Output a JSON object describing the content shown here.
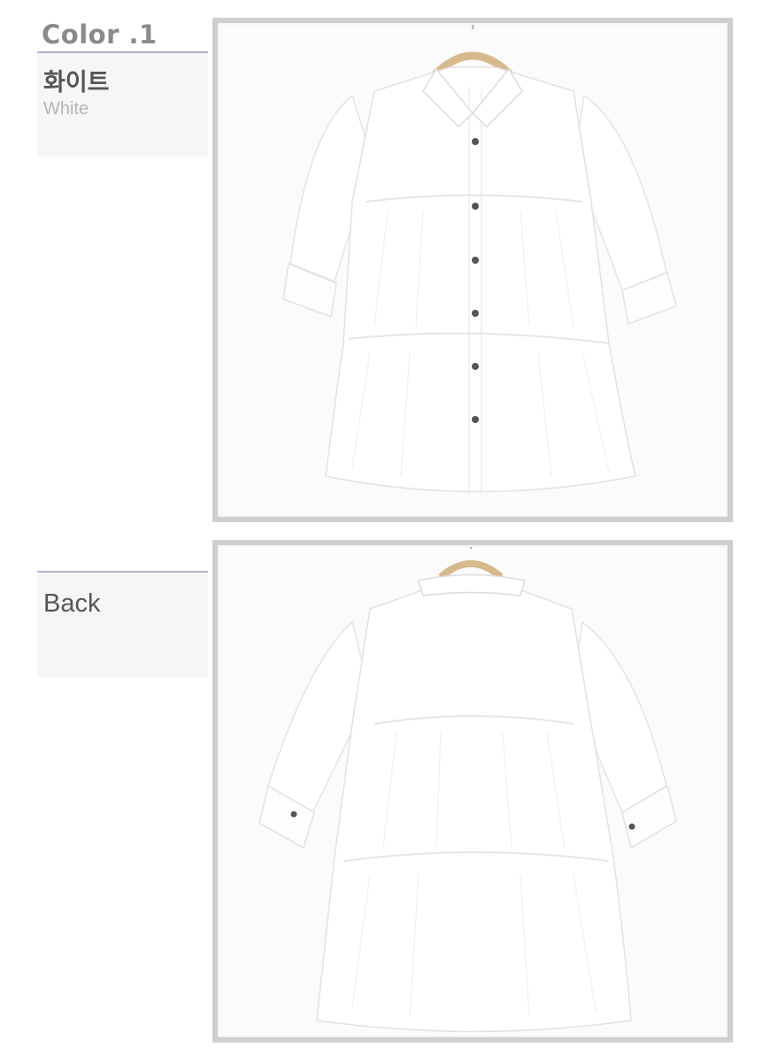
{
  "color_section": {
    "heading": "Color .1",
    "name_ko": "화이트",
    "name_en": "White"
  },
  "back_section": {
    "heading": "Back"
  },
  "photos": [
    {
      "view": "front",
      "subject": "shirt-icon"
    },
    {
      "view": "back",
      "subject": "shirt-icon"
    }
  ],
  "colors": {
    "accent_line": "#b8aed2",
    "frame": "#cfcfcf",
    "label_bg": "#f6f6f6",
    "garment": "#ffffff"
  }
}
